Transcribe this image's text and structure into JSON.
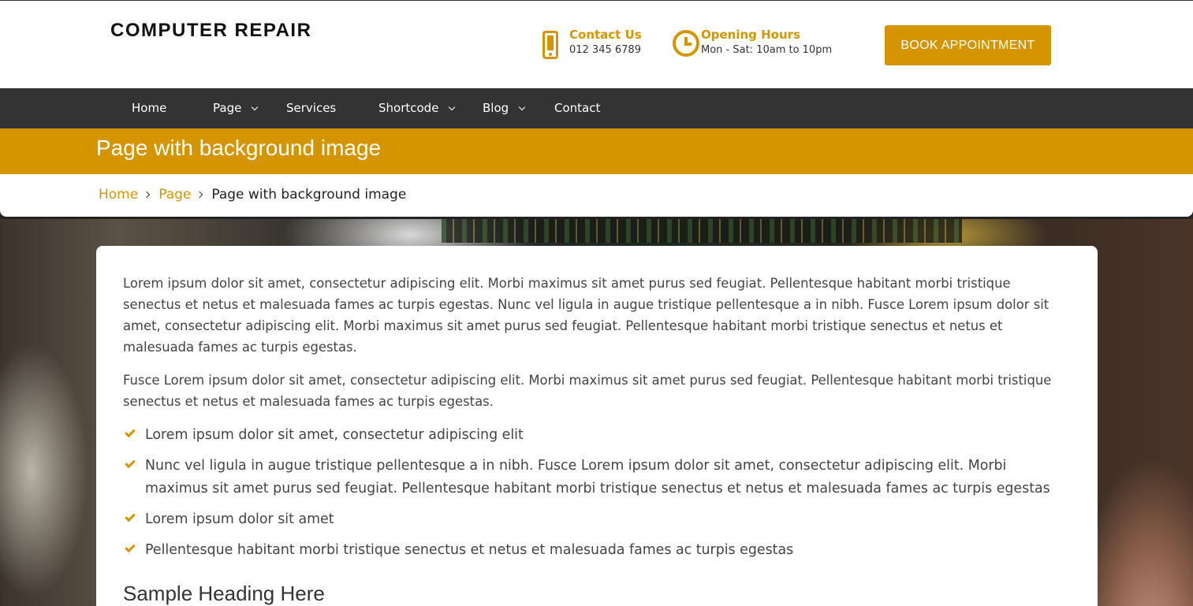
{
  "header": {
    "brand": "COMPUTER REPAIR",
    "contact": {
      "title": "Contact Us",
      "detail": "012 345 6789",
      "icon": "phone-icon"
    },
    "hours": {
      "title": "Opening Hours",
      "detail": "Mon - Sat: 10am to 10pm",
      "icon": "clock-icon"
    },
    "book_label": "BOOK APPOINTMENT"
  },
  "nav": {
    "items": [
      {
        "label": "Home",
        "dropdown": false
      },
      {
        "label": "Page",
        "dropdown": true
      },
      {
        "label": "Services",
        "dropdown": false
      },
      {
        "label": "Shortcode",
        "dropdown": true
      },
      {
        "label": "Blog",
        "dropdown": true
      },
      {
        "label": "Contact",
        "dropdown": false
      }
    ]
  },
  "page": {
    "title": "Page with background image",
    "breadcrumb": [
      "Home",
      "Page",
      "Page with background image"
    ]
  },
  "content": {
    "paragraph1": "Lorem ipsum dolor sit amet, consectetur adipiscing elit. Morbi maximus sit amet purus sed feugiat. Pellentesque habitant morbi tristique senectus et netus et malesuada fames ac turpis egestas. Nunc vel ligula in augue tristique pellentesque a in nibh. Fusce Lorem ipsum dolor sit amet, consectetur adipiscing elit. Morbi maximus sit amet purus sed feugiat. Pellentesque habitant morbi tristique senectus et netus et malesuada fames ac turpis egestas.",
    "paragraph2": "Fusce Lorem ipsum dolor sit amet, consectetur adipiscing elit. Morbi maximus sit amet purus sed feugiat. Pellentesque habitant morbi tristique senectus et netus et malesuada fames ac turpis egestas.",
    "list": [
      "Lorem ipsum dolor sit amet, consectetur adipiscing elit",
      "Nunc vel ligula in augue tristique pellentesque a in nibh. Fusce Lorem ipsum dolor sit amet, consectetur adipiscing elit. Morbi maximus sit amet purus sed feugiat. Pellentesque habitant morbi tristique senectus et netus et malesuada fames ac turpis egestas",
      "Lorem ipsum dolor sit amet",
      "Pellentesque habitant morbi tristique senectus et netus et malesuada fames ac turpis egestas"
    ],
    "heading": "Sample Heading Here"
  },
  "colors": {
    "accent": "#d49500",
    "nav_bg": "#333333",
    "text": "#444444"
  }
}
